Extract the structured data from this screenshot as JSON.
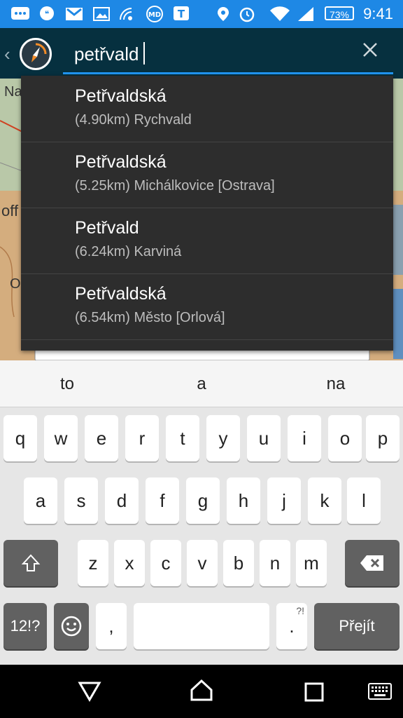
{
  "status_bar": {
    "time": "9:41",
    "battery": "73%",
    "icons": [
      "messages-icon",
      "hangouts-icon",
      "gmail-icon",
      "gallery-icon",
      "wifi-calling-icon",
      "md-icon",
      "t-app-icon",
      "location-icon",
      "alarm-icon",
      "wifi-icon",
      "signal-icon",
      "battery-icon"
    ]
  },
  "search": {
    "query": "petřvald"
  },
  "map": {
    "labels": [
      "Na",
      "off",
      "O"
    ]
  },
  "suggestions": [
    {
      "title": "Petřvaldská",
      "subtitle": "(4.90km) Rychvald"
    },
    {
      "title": "Petřvaldská",
      "subtitle": "(5.25km) Michálkovice [Ostrava]"
    },
    {
      "title": "Petřvald",
      "subtitle": "(6.24km) Karviná"
    },
    {
      "title": "Petřvaldská",
      "subtitle": "(6.54km) Město [Orlová]"
    }
  ],
  "keyboard": {
    "word_suggestions": [
      "to",
      "a",
      "na"
    ],
    "row1": [
      "q",
      "w",
      "e",
      "r",
      "t",
      "y",
      "u",
      "i",
      "o",
      "p"
    ],
    "row2": [
      "a",
      "s",
      "d",
      "f",
      "g",
      "h",
      "j",
      "k",
      "l"
    ],
    "row3": [
      "z",
      "x",
      "c",
      "v",
      "b",
      "n",
      "m"
    ],
    "symbols_label": "12!?",
    "comma_label": ",",
    "period_label": ".",
    "period_hint": "?!",
    "go_label": "Přejít"
  }
}
